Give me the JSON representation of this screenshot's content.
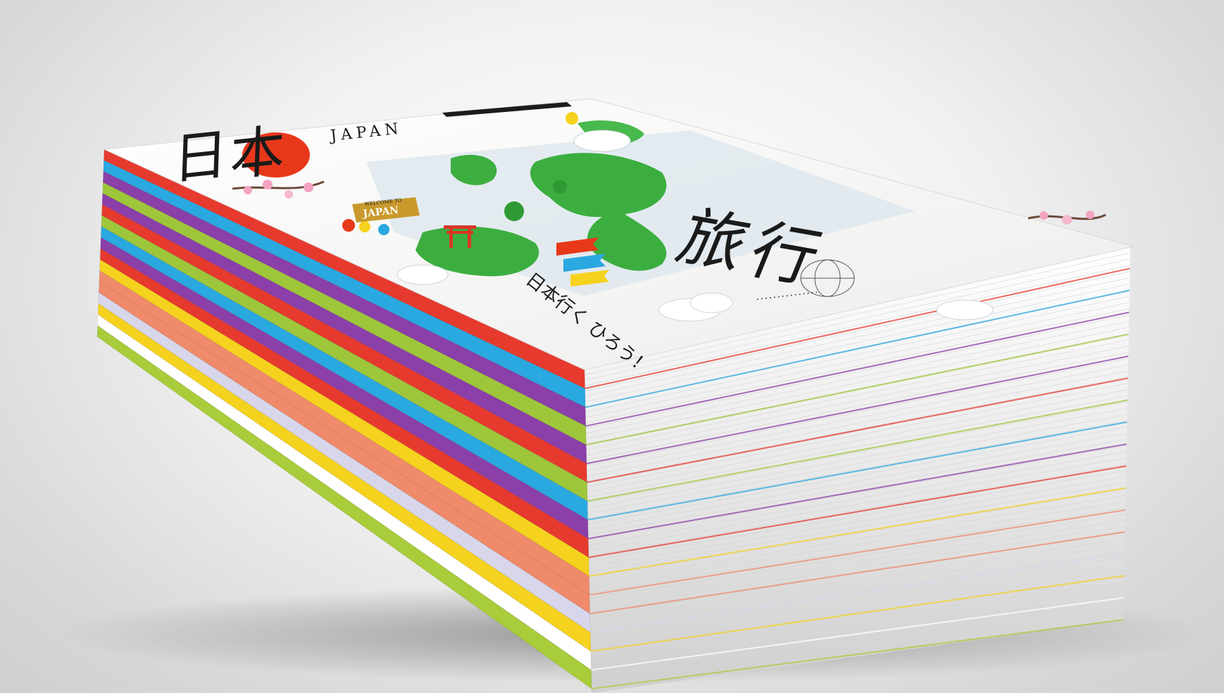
{
  "cover": {
    "title_kanji_left": "日",
    "title_kanji_left2": "本",
    "title_english": "JAPAN",
    "badge": "JAPAN",
    "badge_small": "WELCOME TO",
    "title_kanji_right": "旅",
    "title_kanji_right2": "行",
    "vertical_tagline": "日本行く ひろう！"
  },
  "colors": {
    "background": "#e8e8e8",
    "cover_paper": "#f4f4f2",
    "rising_sun": "#e8381a",
    "map_green": "#3cae3f",
    "spine_colors": [
      "#e63a2e",
      "#2aa8e0",
      "#8b3fa8",
      "#9ec63a",
      "#8b3fa8",
      "#e63a2e",
      "#9ec63a",
      "#2aa8e0",
      "#8b3fa8",
      "#e63a2e",
      "#f5d21e",
      "#ef8a6a",
      "#ef8a6a",
      "#d8d6ea",
      "#f5d21e",
      "#ffffff",
      "#a8cc3a"
    ]
  }
}
